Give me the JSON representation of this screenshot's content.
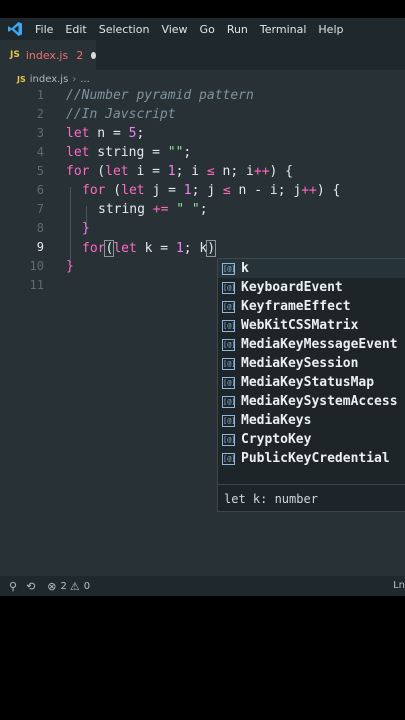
{
  "menu": [
    "File",
    "Edit",
    "Selection",
    "View",
    "Go",
    "Run",
    "Terminal",
    "Help"
  ],
  "tab": {
    "icon": "JS",
    "name": "index.js",
    "problems": "2"
  },
  "breadcrumb": {
    "icon": "JS",
    "file": "index.js",
    "rest": "..."
  },
  "lines": [
    "1",
    "2",
    "3",
    "4",
    "5",
    "6",
    "7",
    "8",
    "9",
    "10",
    "11"
  ],
  "code": {
    "l1": "//Number pyramid pattern",
    "l2": "//In Javscript",
    "l3": {
      "kw": "let",
      "rest": " n = ",
      "num": "5",
      "end": ";"
    },
    "l4": {
      "kw": "let",
      "rest": " string = ",
      "str": "\"\"",
      "end": ";"
    },
    "l5": {
      "kw": "for",
      "a": " (",
      "kw2": "let",
      "b": " i = ",
      "n1": "1",
      "c": "; i ",
      "op": "≤",
      "d": " n; i",
      "op2": "++",
      "e": ") {"
    },
    "l6": {
      "kw": "for",
      "a": " (",
      "kw2": "let",
      "b": " j = ",
      "n1": "1",
      "c": "; j ",
      "op": "≤",
      "d": " n - i; j",
      "op2": "++",
      "e": ") {"
    },
    "l7": {
      "a": "string ",
      "op": "+=",
      "sp": " ",
      "str": "\" \"",
      "end": ";"
    },
    "l8": "}",
    "l9": {
      "kw": "for",
      "p": "(",
      "kw2": "let",
      "b": " k = ",
      "n1": "1",
      "c": "; k",
      "p2": ")"
    },
    "l10": "}"
  },
  "suggestions": [
    "k",
    "KeyboardEvent",
    "KeyframeEffect",
    "WebKitCSSMatrix",
    "MediaKeyMessageEvent",
    "MediaKeySession",
    "MediaKeyStatusMap",
    "MediaKeySystemAccess",
    "MediaKeys",
    "CryptoKey",
    "PublicKeyCredential"
  ],
  "suggestion_icon": "[@]",
  "suggestion_detail": "let k: number",
  "status": {
    "errors": "2",
    "warnings": "0",
    "right": "Ln"
  },
  "colors": {
    "background": "#273136",
    "keyword": "#ff6ac1",
    "number": "#ef83f3",
    "string": "#9ee09e",
    "comment": "#7f93a0"
  }
}
